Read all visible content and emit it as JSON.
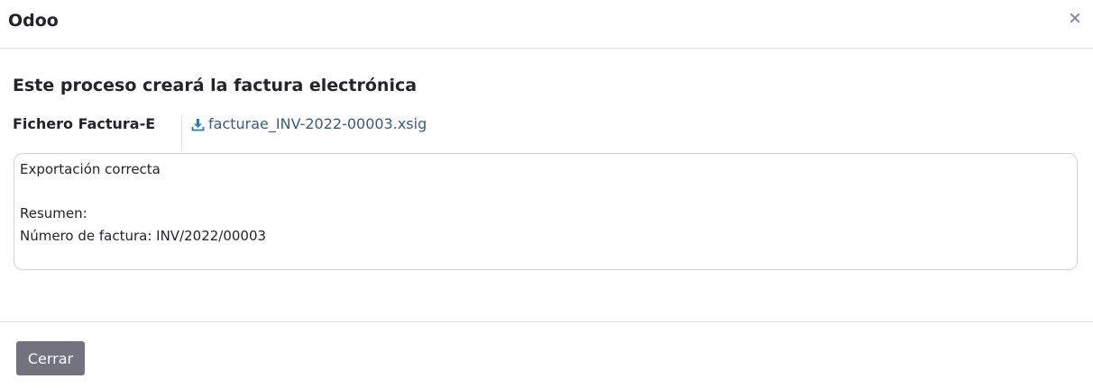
{
  "dialog": {
    "title": "Odoo",
    "close_icon": "close-icon"
  },
  "wizard": {
    "title": "Este proceso creará la factura electrónica",
    "file_field": {
      "label": "Fichero Factura-E",
      "filename": "facturae_INV-2022-00003.xsig",
      "icon": "download-icon"
    },
    "log": "Exportación correcta\n\nResumen:\nNúmero de factura: INV/2022/00003"
  },
  "footer": {
    "close_label": "Cerrar"
  },
  "colors": {
    "link": "#3b5a7d",
    "download_icon": "#2a7ab8",
    "button": "#71737f",
    "border": "#dee2e6"
  }
}
